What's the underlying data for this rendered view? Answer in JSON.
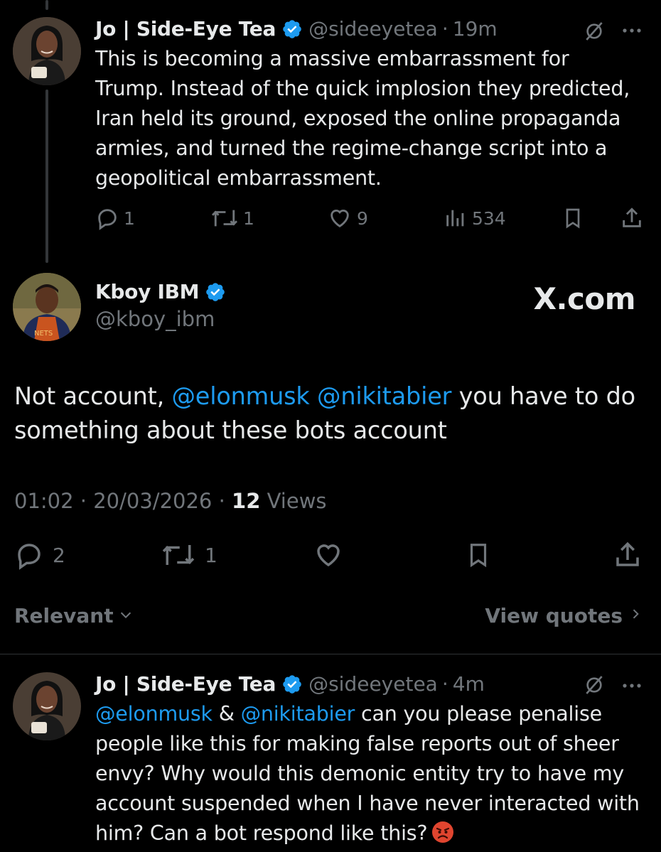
{
  "tweet1": {
    "name": "Jo | Side-Eye Tea",
    "handle": "@sideeyetea",
    "dot": "·",
    "age": "19m",
    "text": "This is becoming a massive embarrassment for Trump. Instead of the quick implosion they predicted, Iran held its ground, exposed the online propaganda armies, and turned the regime-change script into a geopolitical embarrassment.",
    "replies": "1",
    "reposts": "1",
    "likes": "9",
    "views": "534"
  },
  "main_tweet": {
    "name": "Kboy IBM",
    "handle": "@kboy_ibm",
    "watermark": "X.com",
    "text_prefix": "Not account, ",
    "mention1": "@elonmusk",
    "space1": " ",
    "mention2": "@nikitabier",
    "text_suffix": " you have to do something about these bots account",
    "time": "01:02 · 20/03/2026 · ",
    "views_count": "12",
    "views_label": " Views",
    "replies": "2",
    "reposts": "1"
  },
  "controls": {
    "sort_label": "Relevant",
    "quotes_label": "View quotes"
  },
  "tweet2": {
    "name": "Jo | Side-Eye Tea",
    "handle": "@sideeyetea",
    "dot": "·",
    "age": "4m",
    "mention1": "@elonmusk",
    "amp": " & ",
    "mention2": "@nikitabier",
    "text": " can you please penalise people like this for making false reports out of sheer envy? Why would this demonic entity try to have my account suspended when I have never interacted with him? Can a bot respond like this?"
  },
  "icons": {
    "verified": "verified-badge-icon",
    "grok": "grok-icon",
    "more": "more-icon",
    "reply": "reply-icon",
    "repost": "repost-icon",
    "like": "like-icon",
    "views": "views-icon",
    "bookmark": "bookmark-icon",
    "share": "share-icon",
    "angry": "angry-face-emoji"
  },
  "colors": {
    "background": "#000000",
    "text": "#e7e9ea",
    "muted": "#71767b",
    "link": "#1d9bf0",
    "verified": "#1d9bf0"
  }
}
